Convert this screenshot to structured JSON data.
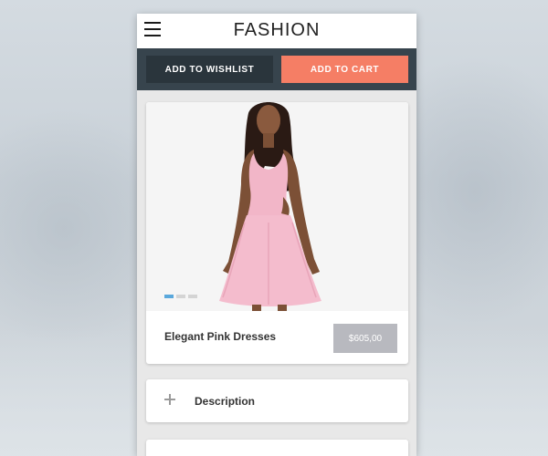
{
  "header": {
    "title": "FASHION",
    "menu_icon": "hamburger-menu-icon"
  },
  "actions": {
    "wishlist_label": "ADD TO WISHLIST",
    "cart_label": "ADD TO CART"
  },
  "product": {
    "name": "Elegant Pink Dresses",
    "price": "$605,00",
    "image_description": "model in pink sleeveless skater dress",
    "carousel": {
      "count": 3,
      "active_index": 0
    }
  },
  "accordion": {
    "items": [
      {
        "label": "Description",
        "icon": "plus-icon"
      }
    ]
  },
  "colors": {
    "action_bar": "#37444d",
    "wishlist_button": "#2a353c",
    "cart_button": "#f57e65",
    "price_badge": "#b8b9bf",
    "carousel_active": "#5aa8dc"
  }
}
